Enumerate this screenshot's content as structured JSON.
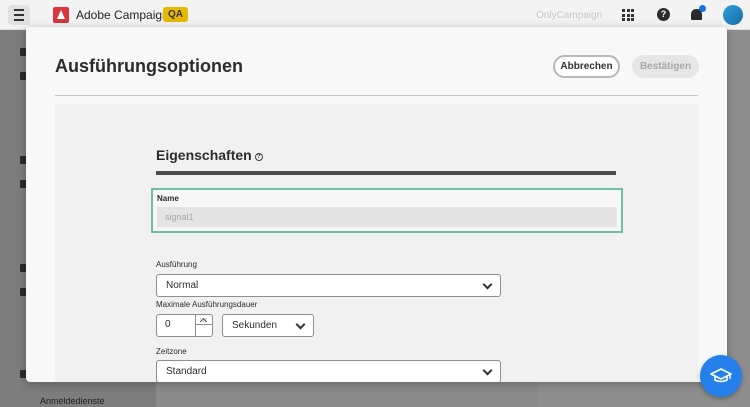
{
  "app": {
    "name": "Adobe Campaign",
    "env_badge": "QA",
    "org": "OnlyCampaign",
    "rail_label": "Anmeldedienste"
  },
  "dialog": {
    "title": "Ausführungsoptionen",
    "cancel_label": "Abbrechen",
    "confirm_label": "Bestätigen"
  },
  "properties": {
    "title": "Eigenschaften",
    "name_label": "Name",
    "name_value": "signal1",
    "execution_label": "Ausführung",
    "execution_value": "Normal",
    "max_duration_label": "Maximale Ausführungsdauer",
    "max_duration_value": "0",
    "duration_unit": "Sekunden",
    "timezone_label": "Zeitzone",
    "timezone_value": "Standard"
  },
  "colors": {
    "accent": "#2680eb",
    "focus_border": "#6cbfa8",
    "badge": "#e6b800",
    "adobe_red": "#d7373f"
  }
}
